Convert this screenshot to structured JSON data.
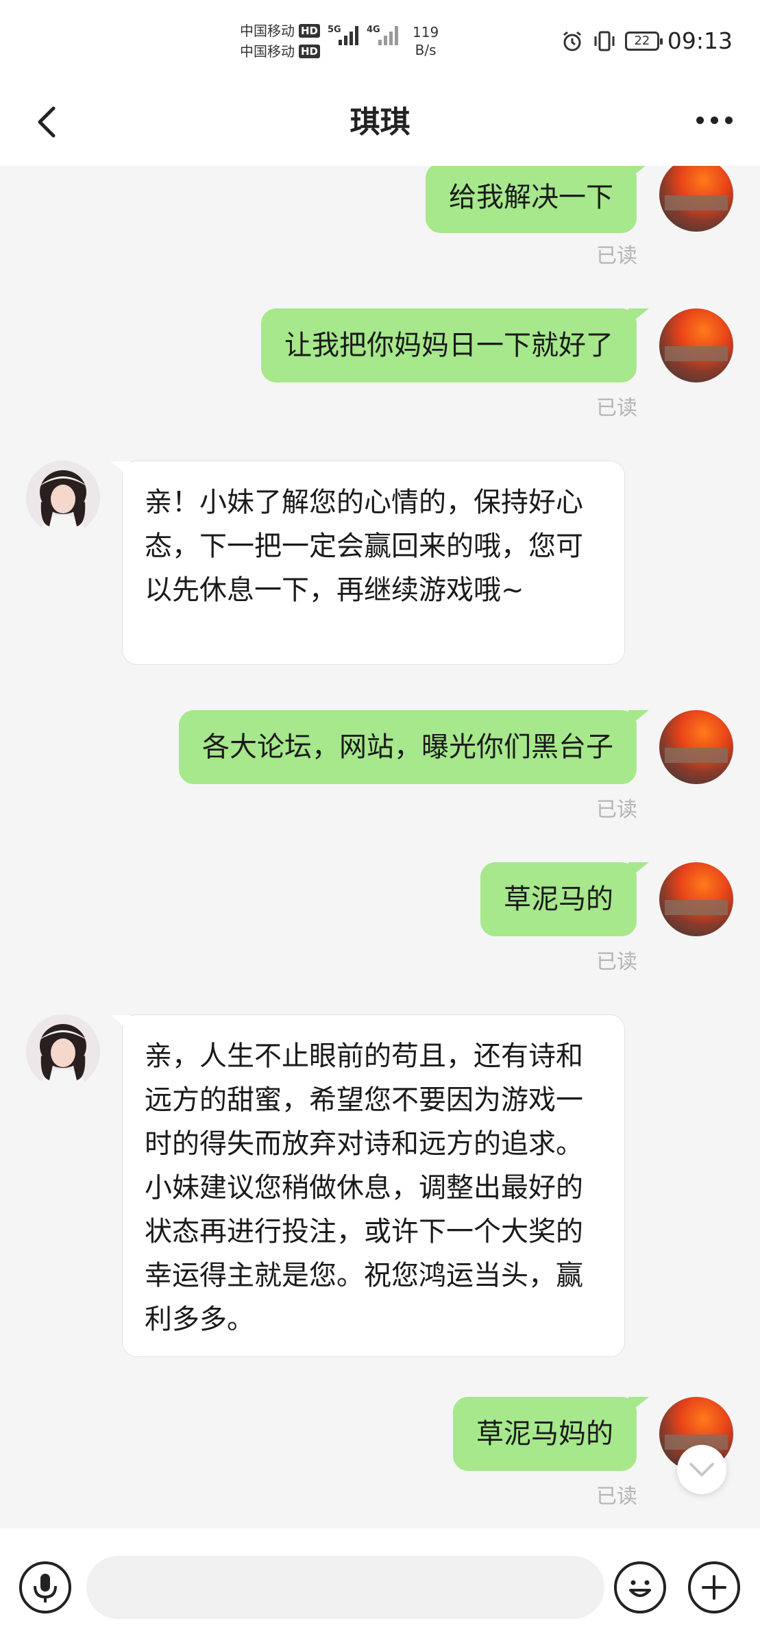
{
  "status_bar": {
    "carrier_1": "中国移动",
    "carrier_2": "中国移动",
    "hd": "HD",
    "net_1": "5G",
    "net_2": "4G",
    "speed_value": "119",
    "speed_unit": "B/s",
    "battery": "22",
    "time": "09:13"
  },
  "header": {
    "title": "琪琪"
  },
  "messages": [
    {
      "sender": "me",
      "text": "给我解决一下",
      "status": "已读"
    },
    {
      "sender": "me",
      "text": "让我把你妈妈日一下就好了",
      "status": "已读"
    },
    {
      "sender": "other",
      "text": "亲！小妹了解您的心情的，保持好心态，下一把一定会赢回来的哦，您可以先休息一下，再继续游戏哦~"
    },
    {
      "sender": "me",
      "text": "各大论坛，网站，曝光你们黑台子",
      "status": "已读"
    },
    {
      "sender": "me",
      "text": "草泥马的",
      "status": "已读"
    },
    {
      "sender": "other",
      "text": "亲，人生不止眼前的苟且，还有诗和远方的甜蜜，希望您不要因为游戏一时的得失而放弃对诗和远方的追求。小妹建议您稍做休息，调整出最好的状态再进行投注，或许下一个大奖的幸运得主就是您。祝您鸿运当头，赢利多多。"
    },
    {
      "sender": "me",
      "text": "草泥马妈的",
      "status": "已读"
    }
  ],
  "input": {
    "placeholder": ""
  },
  "icons": {
    "back": "back-arrow-icon",
    "more": "more-icon",
    "voice": "microphone-icon",
    "emoji": "emoji-icon",
    "add": "plus-icon",
    "scroll": "chevron-down-icon"
  },
  "colors": {
    "my_bubble": "#a6e88b",
    "other_bubble": "#ffffff",
    "background": "#f5f5f5",
    "read_status": "#b5b5b5"
  }
}
